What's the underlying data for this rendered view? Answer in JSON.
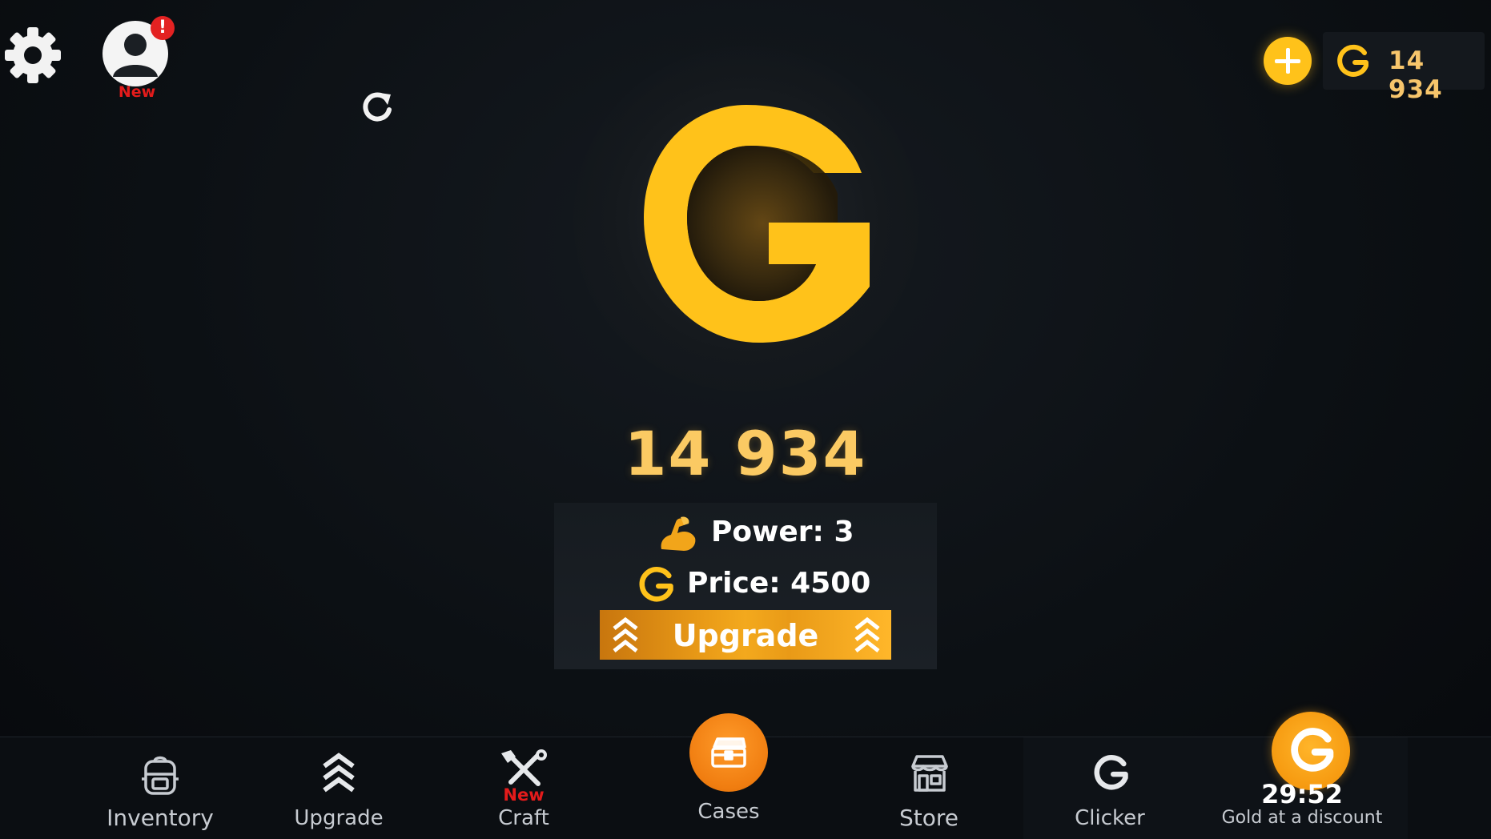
{
  "header": {
    "settings_icon": "gear-icon",
    "profile": {
      "icon": "user-icon",
      "alert": "!",
      "badge": "New"
    },
    "refresh_icon": "refresh-icon",
    "add_gold_icon": "plus-icon",
    "balance": "14 934"
  },
  "clicker": {
    "coin_icon": "gold-g-icon",
    "value": "14 934",
    "power_label": "Power: 3",
    "price_label": "Price: 4500",
    "upgrade_label": "Upgrade"
  },
  "nav": {
    "inventory": "Inventory",
    "upgrade": "Upgrade",
    "craft": "Craft",
    "craft_badge": "New",
    "cases": "Cases",
    "store": "Store",
    "clicker": "Clicker",
    "discount_timer": "29:52",
    "discount": "Gold at a discount"
  },
  "colors": {
    "gold": "#ffc21a",
    "gold_text": "#fbca63",
    "orange": "#f07d10",
    "alert_red": "#e32222",
    "background": "#0b0e12"
  }
}
